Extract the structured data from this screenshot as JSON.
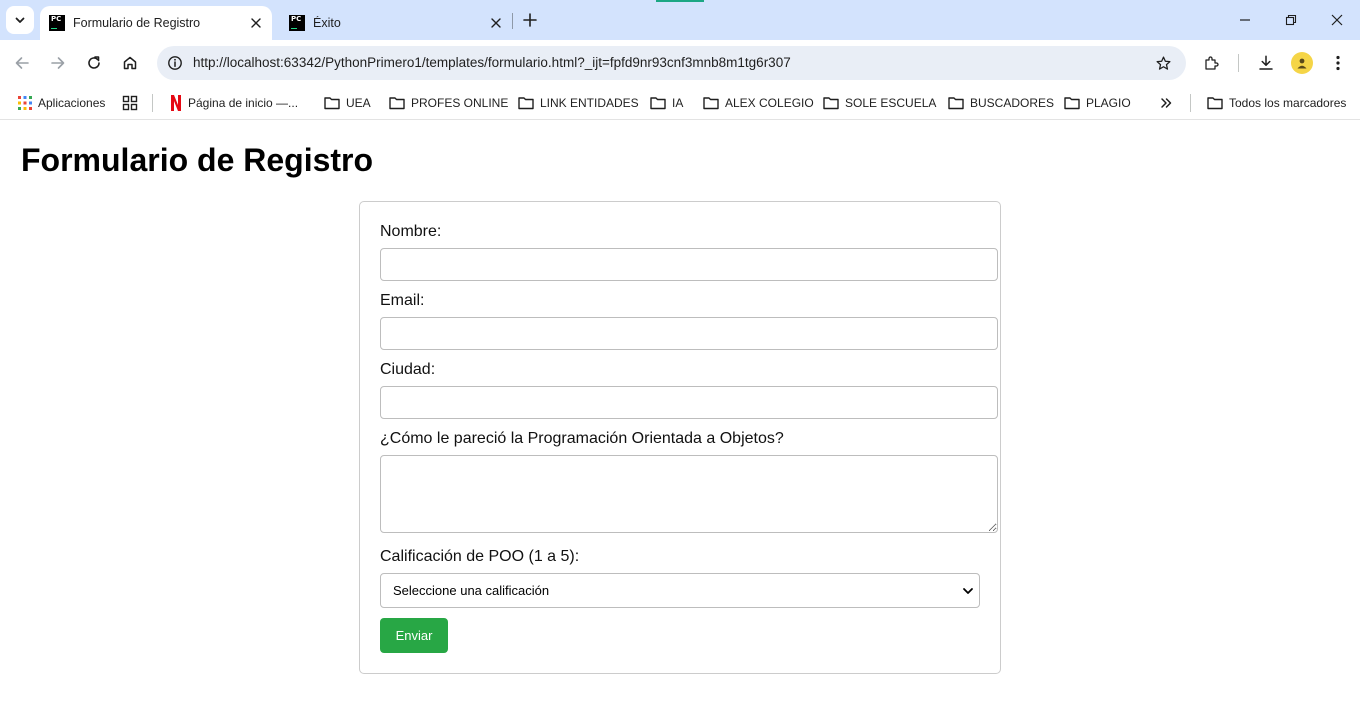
{
  "browser": {
    "tabs": [
      {
        "title": "Formulario de Registro",
        "active": true
      },
      {
        "title": "Éxito",
        "active": false
      }
    ],
    "address_bar": {
      "url": "http://localhost:63342/PythonPrimero1/templates/formulario.html?_ijt=fpfd9nr93cnf3mnb8m1tg6r307"
    },
    "bookmarks": [
      {
        "label": "Aplicaciones",
        "icon": "apps-grid-icon"
      },
      {
        "label": "",
        "icon": "tab-groups-icon"
      },
      {
        "label": "Página de inicio —...",
        "icon": "netflix-icon"
      },
      {
        "label": "UEA",
        "icon": "folder-icon"
      },
      {
        "label": "PROFES ONLINE",
        "icon": "folder-icon"
      },
      {
        "label": "LINK ENTIDADES",
        "icon": "folder-icon"
      },
      {
        "label": "IA",
        "icon": "folder-icon"
      },
      {
        "label": "ALEX COLEGIO",
        "icon": "folder-icon"
      },
      {
        "label": "SOLE ESCUELA",
        "icon": "folder-icon"
      },
      {
        "label": "BUSCADORES",
        "icon": "folder-icon"
      },
      {
        "label": "PLAGIO",
        "icon": "folder-icon"
      }
    ],
    "all_bookmarks_label": "Todos los marcadores",
    "colors": {
      "tabstrip": "#d3e3fd",
      "omnibox": "#e9eef6",
      "accent_green": "#1ba784"
    }
  },
  "page": {
    "title": "Formulario de Registro",
    "form": {
      "name_label": "Nombre:",
      "name_value": "",
      "email_label": "Email:",
      "email_value": "",
      "city_label": "Ciudad:",
      "city_value": "",
      "opinion_label": "¿Cómo le pareció la Programación Orientada a Objetos?",
      "opinion_value": "",
      "rating_label": "Calificación de POO (1 a 5):",
      "rating_selected": "Seleccione una calificación",
      "submit_label": "Enviar"
    },
    "colors": {
      "submit_button": "#28a745",
      "card_border": "#cccccc"
    }
  }
}
